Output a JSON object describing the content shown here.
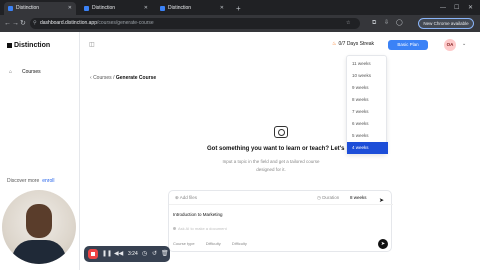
{
  "browser": {
    "tabs": [
      {
        "title": "Distinction",
        "active": true
      },
      {
        "title": "Distinction",
        "active": false
      },
      {
        "title": "Distinction",
        "active": false
      }
    ],
    "url_host": "dashboard.distinction.app",
    "url_path": "/courses/generate-course",
    "update_label": "New Chrome available"
  },
  "sidebar": {
    "logo": "Distinction",
    "items": [
      {
        "label": "Courses",
        "icon": "home-icon"
      }
    ],
    "discover_text": "Discover more",
    "discover_link": "enroll"
  },
  "topbar": {
    "streak": "0/7 Days Streak",
    "upgrade_label": "Basic Plan",
    "avatar_initials": "OA"
  },
  "breadcrumb": {
    "back": "Courses",
    "current": "Generate Course"
  },
  "hero": {
    "title": "Got something you want to learn or teach? Let's dive in",
    "subtitle": "Input a topic in the field and get a tailored course designed for it."
  },
  "composer": {
    "add_files": "Add files",
    "duration_label": "Duration",
    "duration_value": "8 weeks",
    "topic_value": "Introduction to Marketing",
    "hint": "Ask AI to make a document",
    "options": [
      "Course type",
      "Difficulty",
      "Difficulty"
    ]
  },
  "duration_dropdown": {
    "options": [
      "11 weeks",
      "10 weeks",
      "9 weeks",
      "8 weeks",
      "7 weeks",
      "6 weeks",
      "5 weeks",
      "4 weeks"
    ],
    "selected": "4 weeks"
  },
  "recorder": {
    "time": "3:24"
  }
}
